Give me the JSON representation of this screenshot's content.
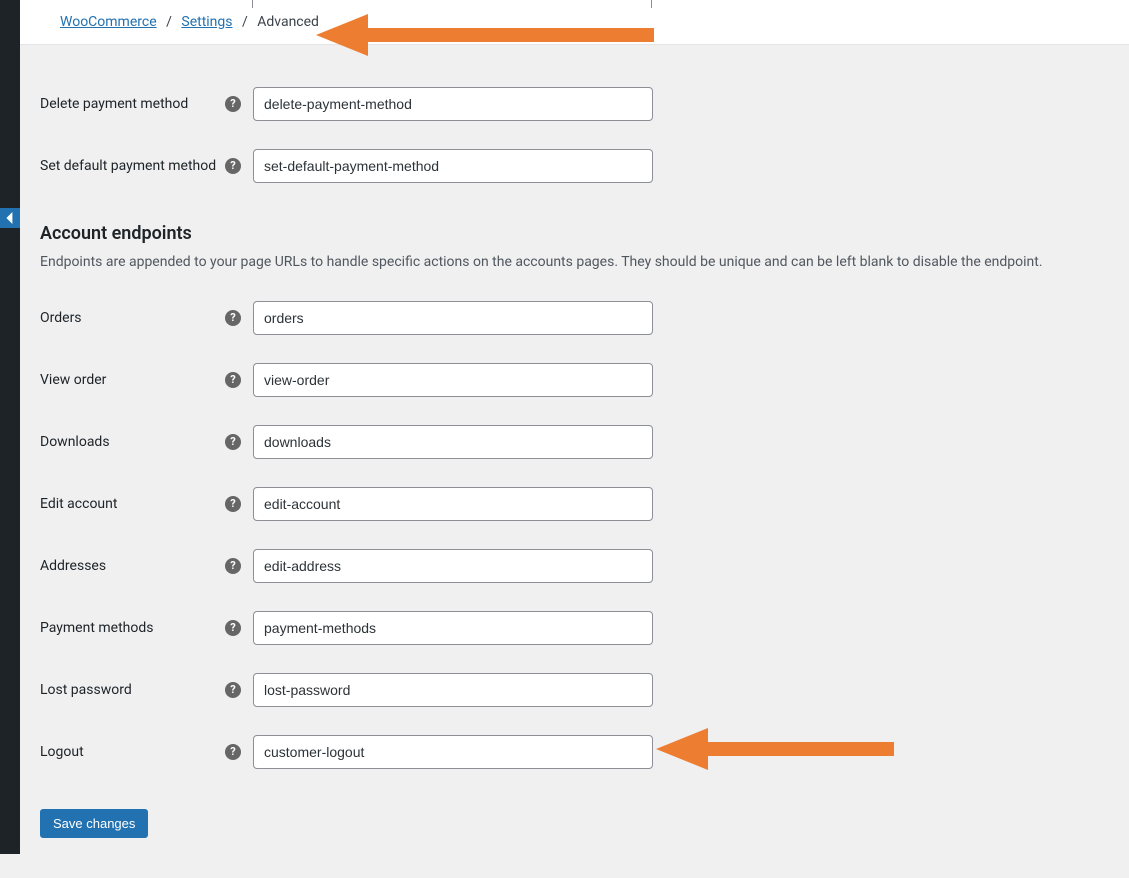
{
  "breadcrumb": {
    "root": "WooCommerce",
    "mid": "Settings",
    "current": "Advanced"
  },
  "top_fields": [
    {
      "label": "Delete payment method",
      "value": "delete-payment-method"
    },
    {
      "label": "Set default payment method",
      "value": "set-default-payment-method"
    }
  ],
  "section": {
    "heading": "Account endpoints",
    "description": "Endpoints are appended to your page URLs to handle specific actions on the accounts pages. They should be unique and can be left blank to disable the endpoint."
  },
  "account_fields": [
    {
      "label": "Orders",
      "value": "orders"
    },
    {
      "label": "View order",
      "value": "view-order"
    },
    {
      "label": "Downloads",
      "value": "downloads"
    },
    {
      "label": "Edit account",
      "value": "edit-account"
    },
    {
      "label": "Addresses",
      "value": "edit-address"
    },
    {
      "label": "Payment methods",
      "value": "payment-methods"
    },
    {
      "label": "Lost password",
      "value": "lost-password"
    },
    {
      "label": "Logout",
      "value": "customer-logout"
    }
  ],
  "save_button": "Save changes"
}
